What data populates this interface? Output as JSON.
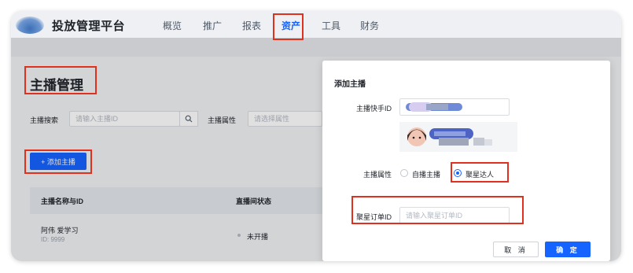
{
  "topbar": {
    "brand": "投放管理平台",
    "nav": [
      {
        "label": "概览"
      },
      {
        "label": "推广"
      },
      {
        "label": "报表"
      },
      {
        "label": "资产"
      },
      {
        "label": "工具"
      },
      {
        "label": "财务"
      }
    ],
    "active_index": 3
  },
  "page": {
    "title": "主播管理",
    "search_label": "主播搜索",
    "search_placeholder": "请输入主播ID",
    "attr_label": "主播属性",
    "attr_placeholder": "请选择属性",
    "add_button": "+ 添加主播"
  },
  "table": {
    "columns": [
      "主播名称与ID",
      "直播间状态"
    ],
    "rows": [
      {
        "name": "阿伟 爱学习",
        "id": "ID: 9999",
        "status": "未开播"
      }
    ]
  },
  "modal": {
    "title": "添加主播",
    "kuaishou_id_label": "主播快手ID",
    "attr_label": "主播属性",
    "options": [
      "自播主播",
      "聚星达人"
    ],
    "selected_option": 1,
    "order_label": "聚星订单ID",
    "order_placeholder": "请输入聚星订单ID",
    "cancel": "取 消",
    "confirm": "确 定"
  },
  "colors": {
    "accent": "#1664ff",
    "annotation": "#e0301e"
  }
}
